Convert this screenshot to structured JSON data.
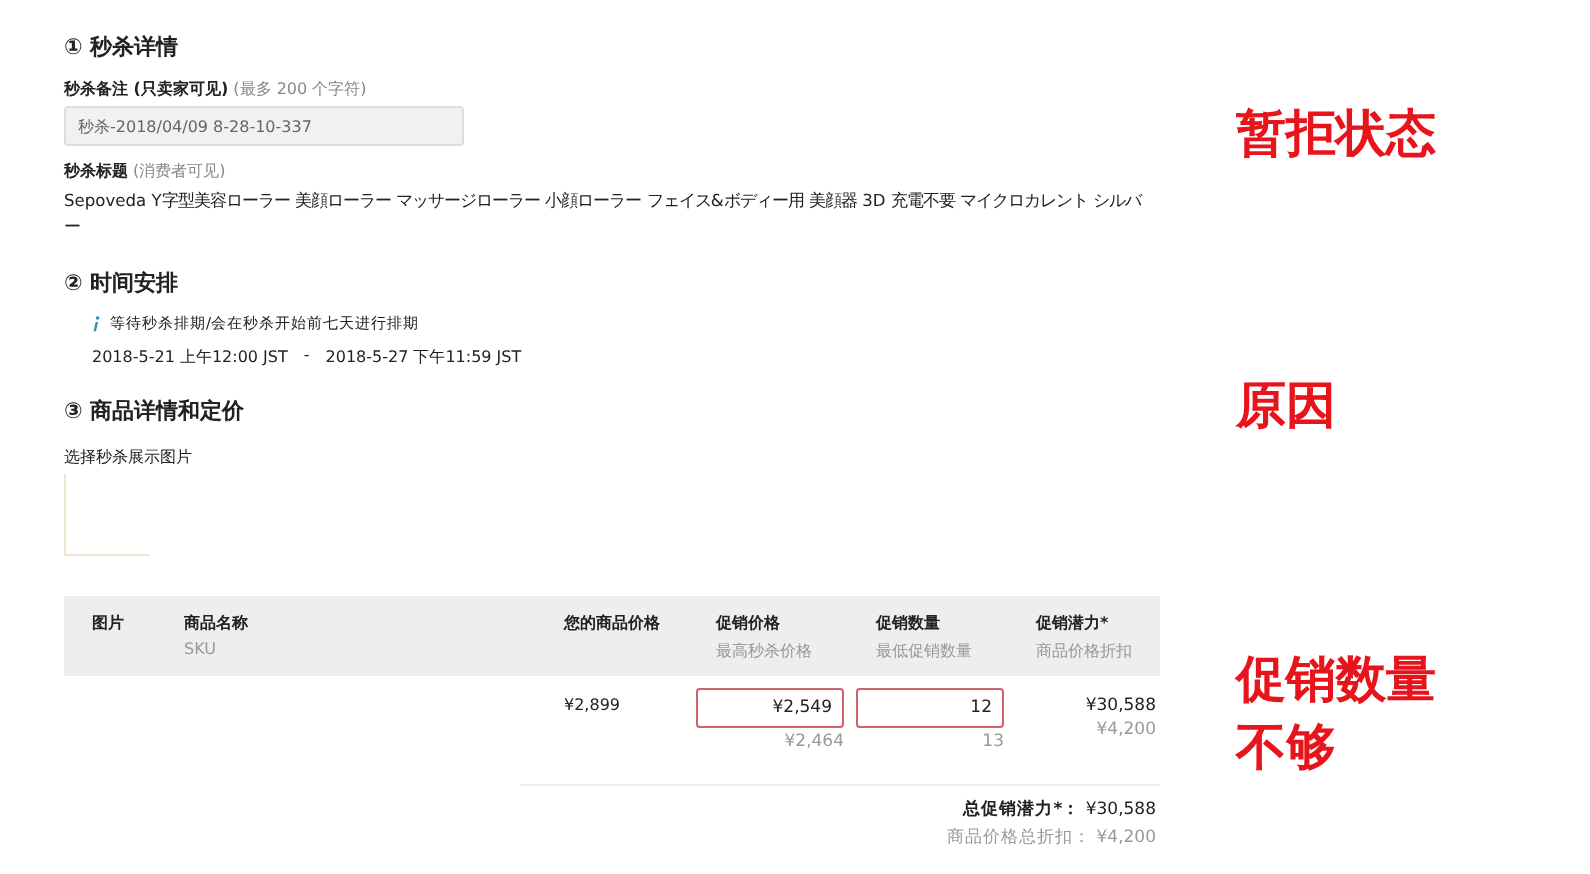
{
  "sections": [
    {
      "number": "①",
      "title": "秒杀详情"
    },
    {
      "number": "②",
      "title": "时间安排"
    },
    {
      "number": "③",
      "title": "商品详情和定价"
    }
  ],
  "note_field": {
    "label": "秒杀备注 (只卖家可见)",
    "hint": "(最多 200 个字符)",
    "value": "秒杀-2018/04/09 8-28-10-337",
    "disabled": true
  },
  "deal_title": {
    "label": "秒杀标题",
    "hint": "(消费者可见)",
    "text": "Sepoveda Y字型美容ローラー 美顔ローラー マッサージローラー 小顔ローラー フェイス&ボディー用 美顔器 3D 充電不要 マイクロカレント シルバー"
  },
  "schedule": {
    "info": "等待秒杀排期/会在秒杀开始前七天进行排期",
    "start": "2018-5-21 上午12:00 JST",
    "separator": "-",
    "end": "2018-5-27 下午11:59 JST"
  },
  "image_picker": {
    "label": "选择秒杀展示图片"
  },
  "table": {
    "columns": [
      {
        "title": "图片"
      },
      {
        "title": "商品名称",
        "subtitle": "SKU"
      },
      {
        "title": "您的商品价格"
      },
      {
        "title": "促销价格",
        "subtitle": "最高秒杀价格"
      },
      {
        "title": "促销数量",
        "subtitle": "最低促销数量"
      },
      {
        "title": "促销潜力*",
        "subtitle": "商品价格折扣"
      }
    ],
    "rows": [
      {
        "your_price": "¥2,899",
        "deal_price": {
          "value": "¥2,549",
          "invalid": true
        },
        "max_deal_price": "¥2,464",
        "quantity": {
          "value": "12",
          "invalid": true
        },
        "min_quantity": "13",
        "potential": "¥30,588",
        "discount": "¥4,200"
      }
    ],
    "totals": [
      {
        "label": "总促销潜力*：",
        "value": "¥30,588",
        "kind": "strong"
      },
      {
        "label": "商品价格总折扣：",
        "value": "¥4,200",
        "kind": "muted"
      }
    ]
  },
  "annotations": [
    {
      "text": "暂拒状态"
    },
    {
      "text": "原因"
    },
    {
      "text": "促销数量不够"
    }
  ]
}
